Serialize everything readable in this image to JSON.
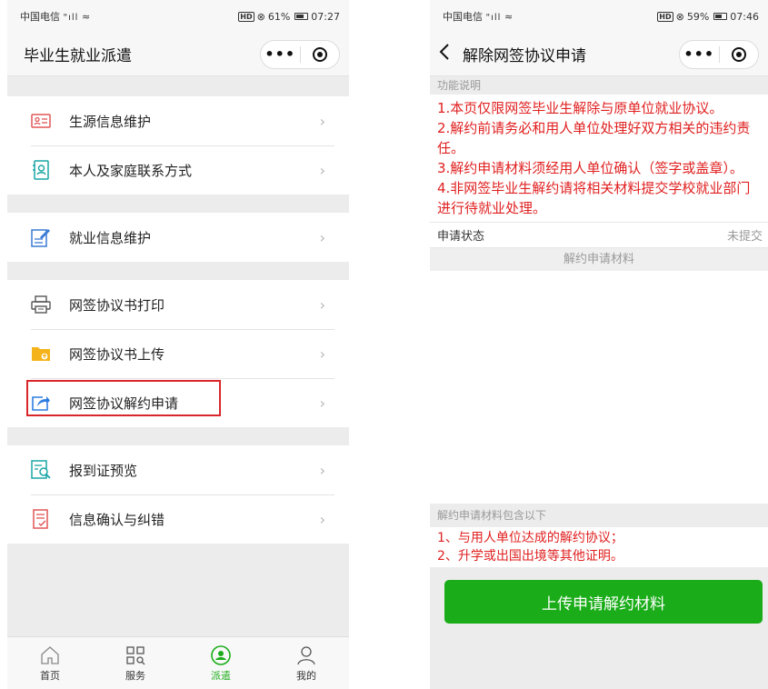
{
  "left": {
    "status": {
      "carrier": "中国电信",
      "signal": "\"ıll",
      "battery_pct": "61%",
      "time": "07:27"
    },
    "nav_title": "毕业生就业派遣",
    "groups": [
      [
        {
          "label": "生源信息维护",
          "icon": "id-card-icon"
        },
        {
          "label": "本人及家庭联系方式",
          "icon": "contact-icon"
        }
      ],
      [
        {
          "label": "就业信息维护",
          "icon": "edit-document-icon"
        }
      ],
      [
        {
          "label": "网签协议书打印",
          "icon": "printer-icon"
        },
        {
          "label": "网签协议书上传",
          "icon": "folder-upload-icon"
        },
        {
          "label": "网签协议解约申请",
          "icon": "share-export-icon"
        }
      ],
      [
        {
          "label": "报到证预览",
          "icon": "preview-icon"
        },
        {
          "label": "信息确认与纠错",
          "icon": "checklist-icon"
        }
      ]
    ],
    "tabs": [
      {
        "label": "首页",
        "icon": "home-icon"
      },
      {
        "label": "服务",
        "icon": "grid-icon"
      },
      {
        "label": "派遣",
        "icon": "dispatch-icon"
      },
      {
        "label": "我的",
        "icon": "user-icon"
      }
    ]
  },
  "right": {
    "status": {
      "carrier": "中国电信",
      "signal": "\"ıll",
      "battery_pct": "59%",
      "time": "07:46"
    },
    "nav_title": "解除网签协议申请",
    "section_label": "功能说明",
    "desc_lines": [
      "1.本页仅限网签毕业生解除与原单位就业协议。",
      "2.解约前请务必和用人单位处理好双方相关的违约责任。",
      "3.解约申请材料须经用人单位确认（签字或盖章）。",
      "4.非网签毕业生解约请将相关材料提交学校就业部门进行待就业处理。"
    ],
    "status_key": "申请状态",
    "status_value": "未提交",
    "materials_header": "解约申请材料",
    "materials_label": "解约申请材料包含以下",
    "materials_lines": [
      "1、与用人单位达成的解约协议；",
      "2、升学或出国出境等其他证明。"
    ],
    "upload_button": "上传申请解约材料"
  },
  "colors": {
    "accent_green": "#1aad19",
    "warning_red": "#e02020",
    "highlight_red": "#d9262b"
  }
}
